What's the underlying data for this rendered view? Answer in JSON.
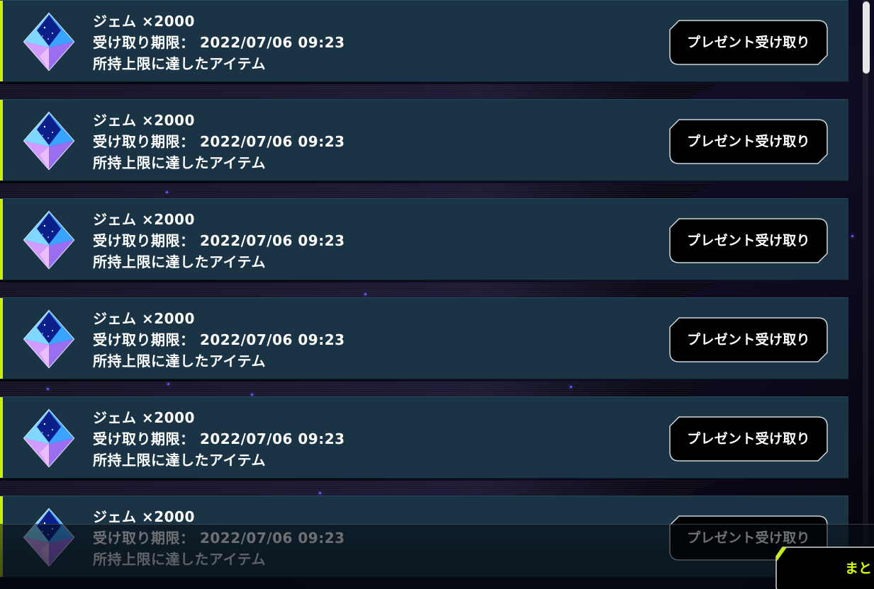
{
  "presents": [
    {
      "item_name": "ジェム ×2000",
      "deadline": "受け取り期限： 2022/07/06 09:23",
      "note": "所持上限に達したアイテム",
      "button_label": "プレゼント受け取り",
      "icon": "gem-icon"
    },
    {
      "item_name": "ジェム ×2000",
      "deadline": "受け取り期限： 2022/07/06 09:23",
      "note": "所持上限に達したアイテム",
      "button_label": "プレゼント受け取り",
      "icon": "gem-icon"
    },
    {
      "item_name": "ジェム ×2000",
      "deadline": "受け取り期限： 2022/07/06 09:23",
      "note": "所持上限に達したアイテム",
      "button_label": "プレゼント受け取り",
      "icon": "gem-icon"
    },
    {
      "item_name": "ジェム ×2000",
      "deadline": "受け取り期限： 2022/07/06 09:23",
      "note": "所持上限に達したアイテム",
      "button_label": "プレゼント受け取り",
      "icon": "gem-icon"
    },
    {
      "item_name": "ジェム ×2000",
      "deadline": "受け取り期限： 2022/07/06 09:23",
      "note": "所持上限に達したアイテム",
      "button_label": "プレゼント受け取り",
      "icon": "gem-icon"
    },
    {
      "item_name": "ジェム ×2000",
      "deadline": "受け取り期限： 2022/07/06 09:23",
      "note": "所持上限に達したアイテム",
      "button_label": "プレゼント受け取り",
      "icon": "gem-icon"
    }
  ],
  "bulk_button": {
    "label": "まと"
  },
  "colors": {
    "row_background": "#1a3446",
    "row_accent": "#c8f000",
    "button_background": "#000000",
    "bulk_label": "#d6ff00"
  }
}
